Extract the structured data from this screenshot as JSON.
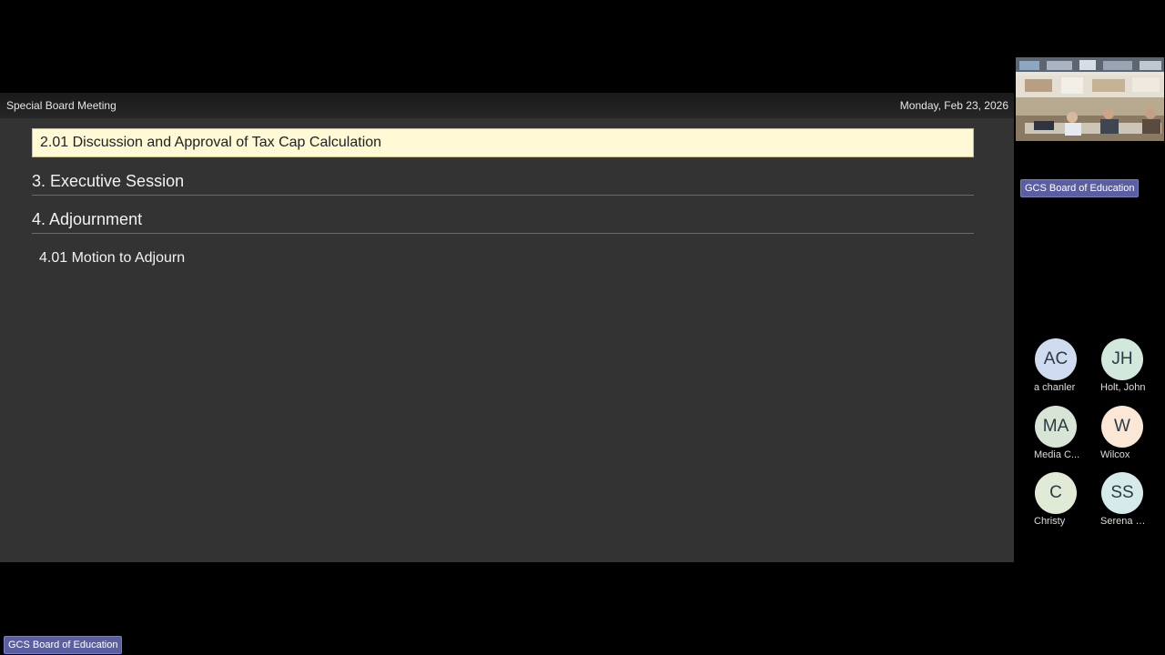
{
  "meeting": {
    "title": "Special Board Meeting",
    "date": "Monday, Feb 23, 2026"
  },
  "agenda": {
    "active_item": "2.01 Discussion and Approval of Tax Cap Calculation",
    "items": [
      {
        "label": "3. Executive Session"
      },
      {
        "label": "4. Adjournment"
      }
    ],
    "sub_item": "4.01 Motion to Adjourn"
  },
  "speaker": {
    "name_label": "GCS Board of Education"
  },
  "bottom_name_label": "GCS Board of Education",
  "participants": [
    {
      "initials": "AC",
      "name": "a chanler",
      "bg": "#cfdcef"
    },
    {
      "initials": "JH",
      "name": "Holt, John",
      "bg": "#d3e8dd"
    },
    {
      "initials": "MA",
      "name": "Media C...",
      "bg": "#d8e4d6"
    },
    {
      "initials": "W",
      "name": "Wilcox",
      "bg": "#fbe7d6"
    },
    {
      "initials": "C",
      "name": "Christy",
      "bg": "#e0ead7"
    },
    {
      "initials": "SS",
      "name": "Serena S...",
      "bg": "#d6eaea"
    }
  ]
}
